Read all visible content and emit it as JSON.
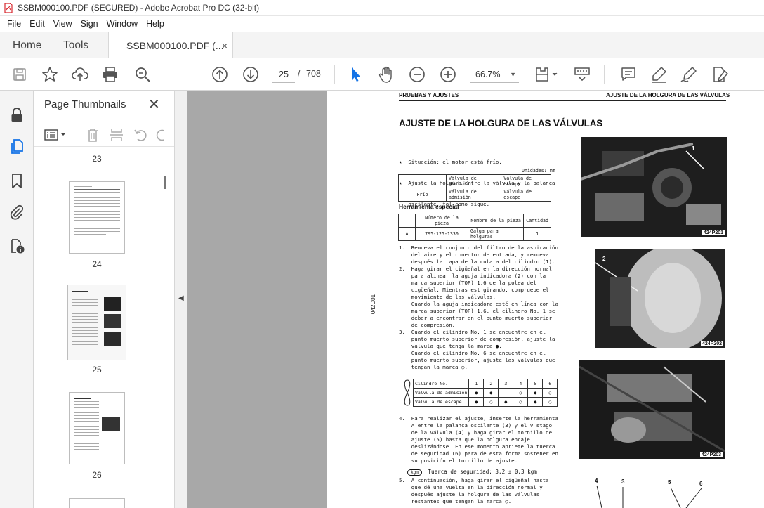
{
  "window": {
    "title": "SSBM000100.PDF (SECURED) - Adobe Acrobat Pro DC (32-bit)"
  },
  "menu": [
    "File",
    "Edit",
    "View",
    "Sign",
    "Window",
    "Help"
  ],
  "tabs": {
    "home": "Home",
    "tools": "Tools",
    "document": "SSBM000100.PDF (...",
    "close": "×"
  },
  "toolbar": {
    "current_page": "25",
    "page_separator": "/",
    "total_pages": "708",
    "zoom": "66.7%",
    "icons": [
      "save-icon",
      "bookmark-star-icon",
      "upload-icon",
      "print-icon",
      "search-zoom-icon",
      "page-up-icon",
      "page-down-icon",
      "select-cursor-icon",
      "hand-icon",
      "zoom-out-icon",
      "zoom-in-icon",
      "fit-page-icon",
      "scroll-mode-icon",
      "comment-icon",
      "highlight-icon",
      "sign-icon",
      "edit-pdf-icon"
    ],
    "accent": "#1473e6"
  },
  "thumbnails_panel": {
    "title": "Page Thumbnails",
    "close": "✕",
    "pages": [
      {
        "label": "23"
      },
      {
        "label": "24"
      },
      {
        "label": "25",
        "selected": true
      },
      {
        "label": "26"
      }
    ]
  },
  "document_page": {
    "header_left": "PRUEBAS Y AJUSTES",
    "header_right": "AJUSTE DE LA HOLGURA DE LAS VÁLVULAS",
    "title": "AJUSTE DE LA HOLGURA DE LAS VÁLVULAS",
    "intro": [
      "★  Situación: el motor está frío.",
      "★  Ajuste la holgura entre la válvula y la palanca",
      "   oscilante, tal como sigue."
    ],
    "units_label": "Unidades: mm",
    "clearance_table": {
      "headers": [
        "",
        "Válvula de admisión",
        "Válvula de escape"
      ],
      "rows": [
        [
          "Frío",
          "Válvula de admisión",
          "Válvula de escape"
        ]
      ]
    },
    "tools_heading": "Herramienta especial",
    "tools_table": {
      "headers": [
        "",
        "Número de la pieza",
        "Nombre de la pieza",
        "Cantidad"
      ],
      "rows": [
        [
          "A",
          "795-125-1330",
          "Galga para holguras",
          "1"
        ]
      ]
    },
    "steps": [
      "1.  Remueva el conjunto del filtro de la aspiración",
      "    del aire y el conector de entrada, y remueva",
      "    después la tapa de la culata del cilindro (1).",
      "2.  Haga girar el cigüeñal en la dirección normal",
      "    para alinear la aguja indicadora (2) con la",
      "    marca superior (TOP) 1,6 de la polea del",
      "    cigüeñal. Mientras est girando, compruebe el",
      "    movimiento de las válvulas.",
      "    Cuando la aguja indicadora esté en línea con la",
      "    marca superior (TOP) 1,6, el cilindro No. 1 se",
      "    deber a encontrar en el punto muerto superior",
      "    de compresión.",
      "3.  Cuando el cilindro No. 1 se encuentre en el",
      "    punto muerto superior de compresión, ajuste la",
      "    válvula que tenga la marca ●.",
      "    Cuando el cilindro No. 6 se encuentre en el",
      "    punto muerto superior, ajuste las válvulas que",
      "    tengan la marca ○."
    ],
    "cylinder_table": {
      "header": [
        "Cilindro No.",
        "1",
        "2",
        "3",
        "4",
        "5",
        "6"
      ],
      "rows": [
        [
          "Válvula de admisión",
          "●",
          "●",
          "",
          "○",
          "●",
          "○"
        ],
        [
          "Válvula de escape",
          "●",
          "○",
          "●",
          "○",
          "●",
          "○"
        ]
      ]
    },
    "steps_b": [
      "4.  Para realizar el ajuste, inserte la herramienta",
      "    A entre la palanca oscilante (3) y el v stago",
      "    de la válvula (4) y haga girar el tornillo de",
      "    ajuste (5) hasta que la holgura encaje",
      "    deslizándose. En ese momento apriete la tuerca",
      "    de seguridad (6) para de esta forma sostener en",
      "    su posición el tornillo de ajuste."
    ],
    "torque_badge": "kgm",
    "torque_text": "Tuerca de seguridad:   3,2 ± 0,3 kgm",
    "steps_c": [
      "5.  A continuación, haga girar el cigüeñal hasta",
      "    que dé una vuelta en la dirección normal y",
      "    después ajuste la holgura de las válvulas",
      "    restantes que tengan la marca ○."
    ],
    "side_code": "042D01",
    "photos": [
      {
        "code": "424P201",
        "callout": "1"
      },
      {
        "code": "424P202",
        "callout": "2"
      },
      {
        "code": "424P203",
        "callout": ""
      }
    ],
    "diagram_callouts": [
      "4",
      "3",
      "5",
      "6"
    ]
  }
}
